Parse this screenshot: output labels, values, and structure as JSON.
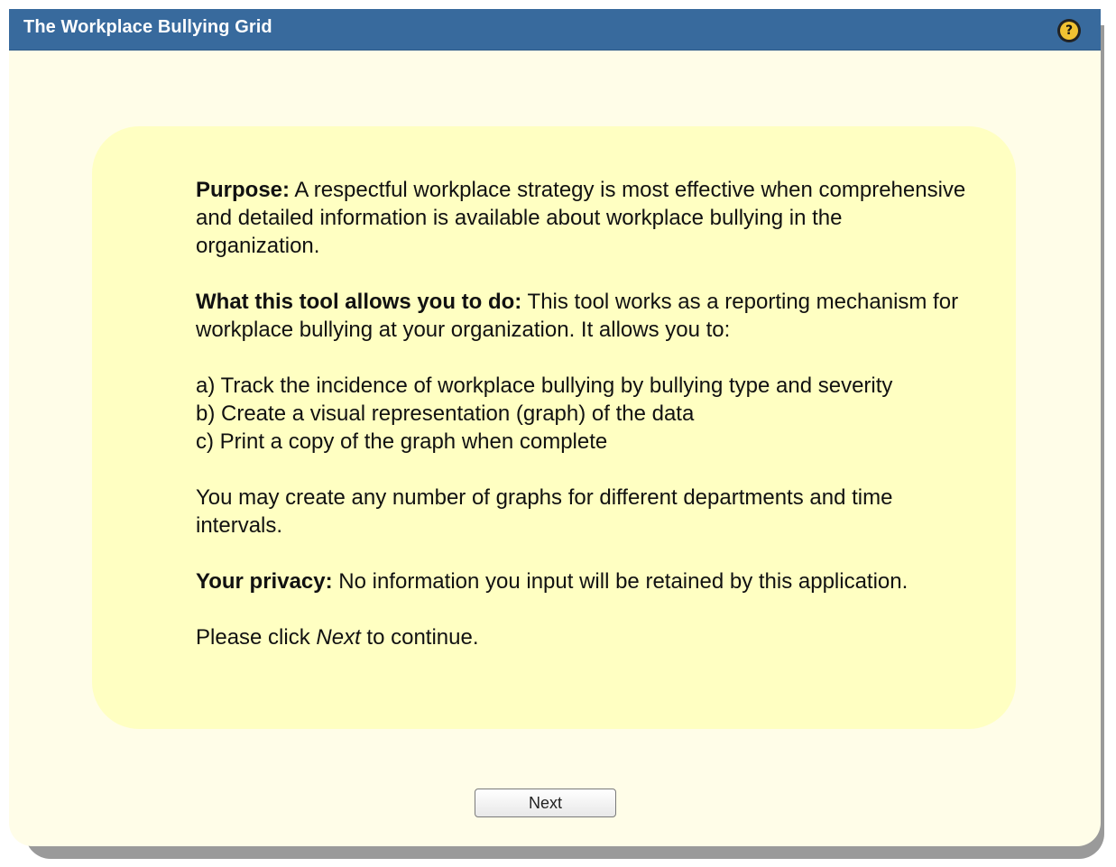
{
  "window": {
    "title": "The Workplace Bullying Grid",
    "help_glyph": "?",
    "help_icon": "help-icon"
  },
  "content": {
    "purpose_label": "Purpose:",
    "purpose_text": " A respectful workplace strategy is most effective when comprehensive and detailed information is available about workplace bullying in the organization.",
    "tool_label": "What this tool allows you to do:",
    "tool_text": " This tool works as a reporting mechanism for workplace bullying at your organization. It allows you to:",
    "list_items": [
      "a) Track the incidence of workplace bullying by bullying type and severity",
      "b) Create a visual representation (graph) of the data",
      "c) Print a copy of the graph when complete"
    ],
    "graphs_text": "You may create any number of graphs for different departments and time intervals.",
    "privacy_label": "Your privacy:",
    "privacy_text": " No information you input will be retained by this application.",
    "continue_prefix": "Please click ",
    "continue_emphasis": "Next",
    "continue_suffix": " to continue."
  },
  "footer": {
    "next_label": "Next"
  },
  "colors": {
    "title_bar": "#386a9d",
    "window_background": "#fffde8",
    "content_background": "#ffffc2",
    "help_icon": "#f1c232"
  }
}
